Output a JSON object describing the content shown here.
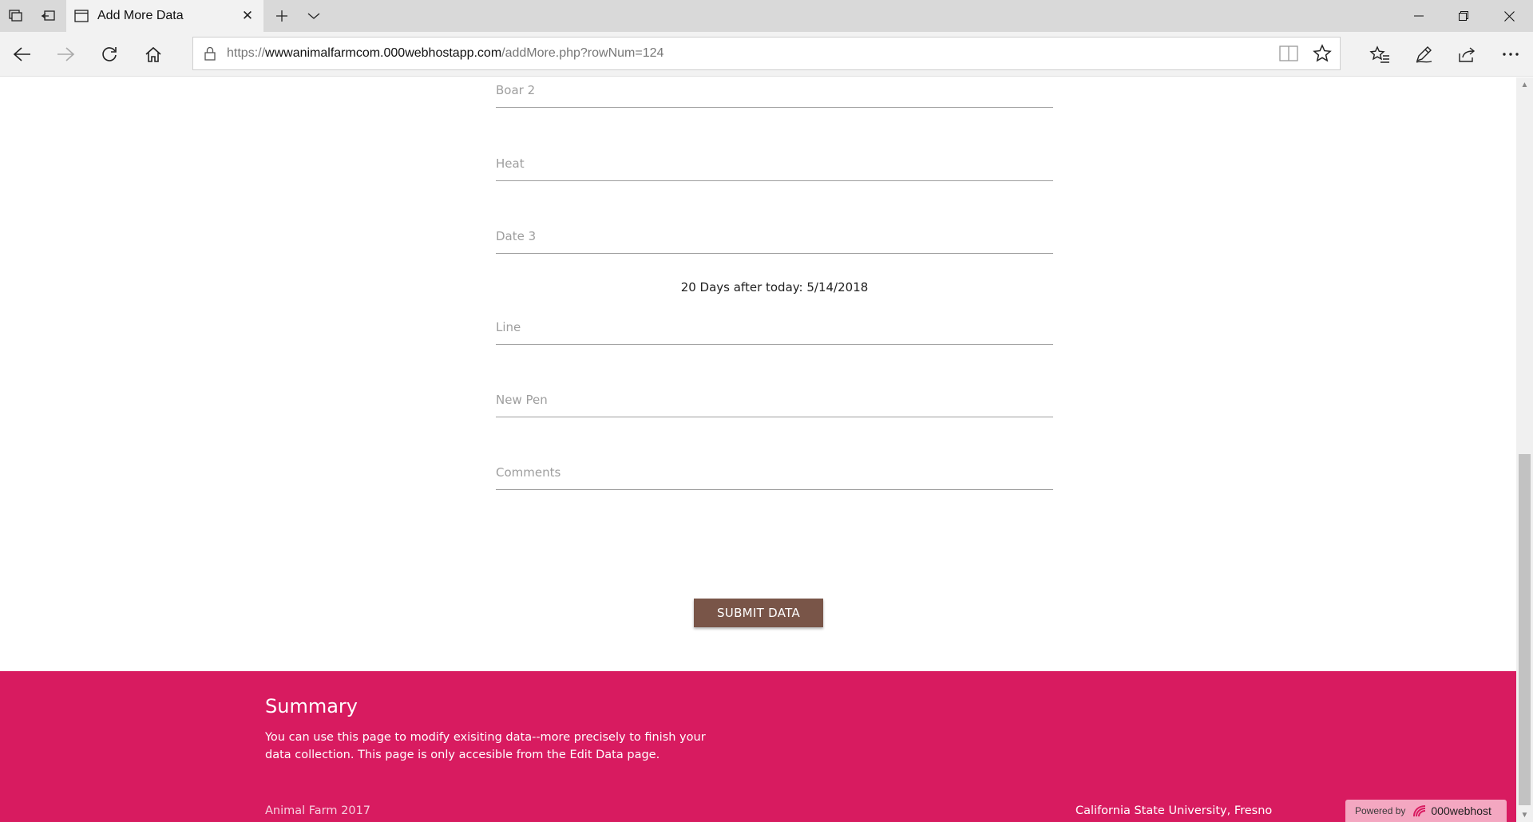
{
  "browser": {
    "tab_title": "Add More Data",
    "url_prefix": "https://",
    "url_host": "wwwanimalfarmcom.000webhostapp.com",
    "url_path": "/addMore.php?rowNum=124"
  },
  "form": {
    "fields": [
      {
        "label": "Boar 2"
      },
      {
        "label": "Heat"
      },
      {
        "label": "Date 3"
      },
      {
        "label": "Line"
      },
      {
        "label": "New Pen"
      },
      {
        "label": "Comments"
      }
    ],
    "date_hint": "20 Days after today: 5/14/2018",
    "submit_label": "SUBMIT DATA"
  },
  "footer": {
    "heading": "Summary",
    "text": "You can use this page to modify exisiting data--more precisely to finish your data collection. This page is only accesible from the Edit Data page.",
    "copyright": "Animal Farm 2017",
    "institution": "California State University, Fresno",
    "powered_by": "Powered by",
    "powered_brand": "000webhost"
  },
  "colors": {
    "footer_bg": "#d81b60",
    "button_bg": "#795548"
  }
}
